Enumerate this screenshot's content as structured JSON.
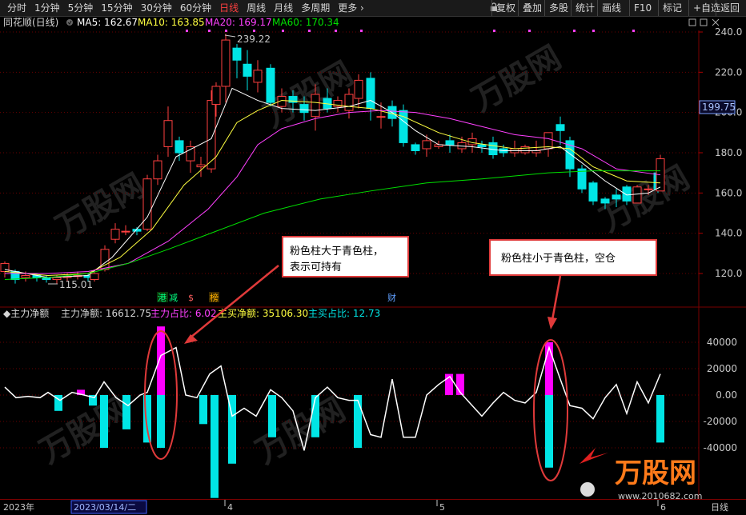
{
  "toolbar": {
    "tabs": [
      "分时",
      "1分钟",
      "5分钟",
      "15分钟",
      "30分钟",
      "60分钟",
      "日线",
      "周线",
      "月线",
      "多周期",
      "更多"
    ],
    "active_tab": "日线",
    "right_buttons": [
      "复权",
      "叠加",
      "多股",
      "统计",
      "画线",
      "F10",
      "标记",
      "+自选",
      "返回"
    ]
  },
  "main_header": {
    "title": "同花顺(日线)",
    "ma5": "MA5: 162.67",
    "ma10": "MA10: 163.85",
    "ma20": "MA20: 169.17",
    "ma60": "MA60: 170.34"
  },
  "price_axis": [
    "240.0",
    "220.0",
    "200.0",
    "180.0",
    "160.0",
    "140.0",
    "120.0"
  ],
  "current_price": "199.75",
  "high_label": "239.22",
  "low_label": "115.01",
  "event_tags": [
    "港",
    "减",
    "$",
    "榜",
    "财"
  ],
  "sub_header": {
    "name": "主力净额",
    "net": "主力净额: 16612.75",
    "ratio": "主力占比: 6.02",
    "buy_net": "主买净额: 35106.30",
    "buy_ratio": "主买占比: 12.73"
  },
  "sub_axis": [
    "40000",
    "20000",
    "0.00",
    "-20000",
    "-40000"
  ],
  "annotations": {
    "left": "粉色柱大于青色柱，表示可持有",
    "right": "粉色柱小于青色柱，空仓"
  },
  "bottom_axis": {
    "year": "2023年",
    "cursor_date": "2023/03/14/二",
    "m4": "4",
    "m5": "5",
    "m6": "6",
    "period": "日线"
  },
  "watermark": "万股网",
  "watermark_url": "www.2010682.com",
  "colors": {
    "up": "#ff4040",
    "down": "#00e5e5",
    "ma5": "#ffffff",
    "ma10": "#ffff40",
    "ma20": "#ff40ff",
    "ma60": "#00e000",
    "pink": "#ff00ff",
    "cyan": "#00e5e5"
  }
}
